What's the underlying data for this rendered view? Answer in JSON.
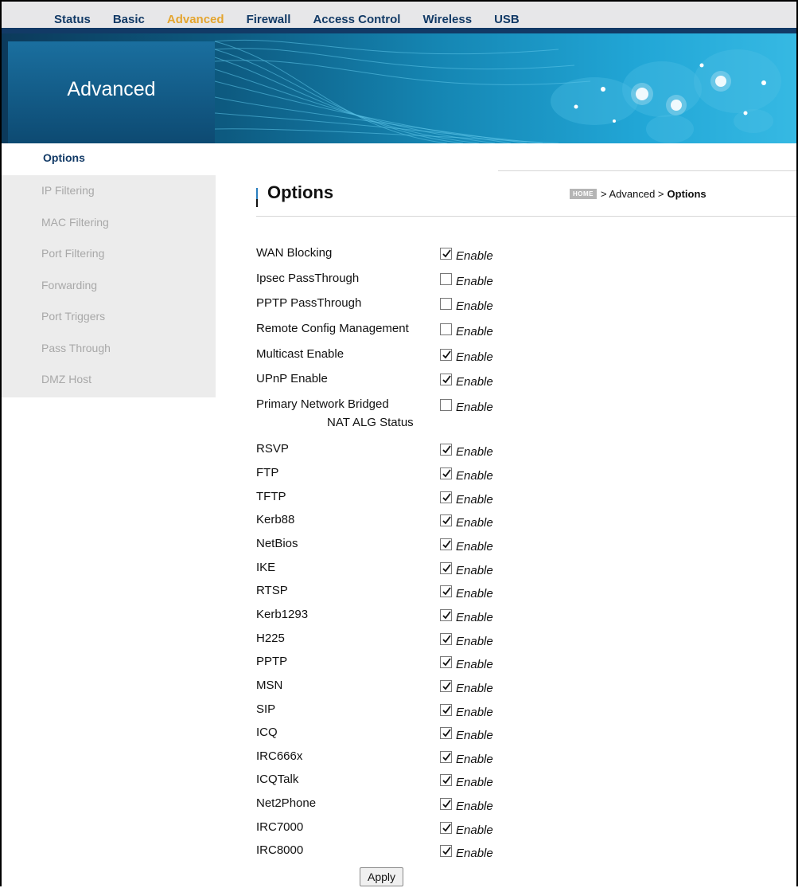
{
  "topnav": {
    "items": [
      {
        "label": "Status",
        "active": false
      },
      {
        "label": "Basic",
        "active": false
      },
      {
        "label": "Advanced",
        "active": true
      },
      {
        "label": "Firewall",
        "active": false
      },
      {
        "label": "Access Control",
        "active": false
      },
      {
        "label": "Wireless",
        "active": false
      },
      {
        "label": "USB",
        "active": false
      }
    ]
  },
  "banner": {
    "title": "Advanced"
  },
  "sidebar": {
    "active": "Options",
    "items": [
      "IP Filtering",
      "MAC Filtering",
      "Port Filtering",
      "Forwarding",
      "Port Triggers",
      "Pass Through",
      "DMZ Host"
    ]
  },
  "page": {
    "title": "Options",
    "breadcrumb": {
      "home": "HOME",
      "path": "> Advanced >",
      "current": "Options"
    }
  },
  "options": {
    "enable_label": "Enable",
    "nat_header": "NAT ALG Status",
    "general": [
      {
        "label": "WAN Blocking",
        "checked": true
      },
      {
        "label": "Ipsec PassThrough",
        "checked": false
      },
      {
        "label": "PPTP PassThrough",
        "checked": false
      },
      {
        "label": "Remote Config Management",
        "checked": false
      },
      {
        "label": "Multicast Enable",
        "checked": true
      },
      {
        "label": "UPnP Enable",
        "checked": true
      },
      {
        "label": "Primary Network Bridged",
        "checked": false
      }
    ],
    "nat_alg": [
      {
        "label": "RSVP",
        "checked": true
      },
      {
        "label": "FTP",
        "checked": true
      },
      {
        "label": "TFTP",
        "checked": true
      },
      {
        "label": "Kerb88",
        "checked": true
      },
      {
        "label": "NetBios",
        "checked": true
      },
      {
        "label": "IKE",
        "checked": true
      },
      {
        "label": "RTSP",
        "checked": true
      },
      {
        "label": "Kerb1293",
        "checked": true
      },
      {
        "label": "H225",
        "checked": true
      },
      {
        "label": "PPTP",
        "checked": true
      },
      {
        "label": "MSN",
        "checked": true
      },
      {
        "label": "SIP",
        "checked": true
      },
      {
        "label": "ICQ",
        "checked": true
      },
      {
        "label": "IRC666x",
        "checked": true
      },
      {
        "label": "ICQTalk",
        "checked": true
      },
      {
        "label": "Net2Phone",
        "checked": true
      },
      {
        "label": "IRC7000",
        "checked": true
      },
      {
        "label": "IRC8000",
        "checked": true
      }
    ],
    "apply_label": "Apply"
  },
  "colors": {
    "nav_text": "#123a66",
    "nav_active": "#e4a52f",
    "accent": "#2a7fbf",
    "sidebar_bg": "#ececec"
  }
}
